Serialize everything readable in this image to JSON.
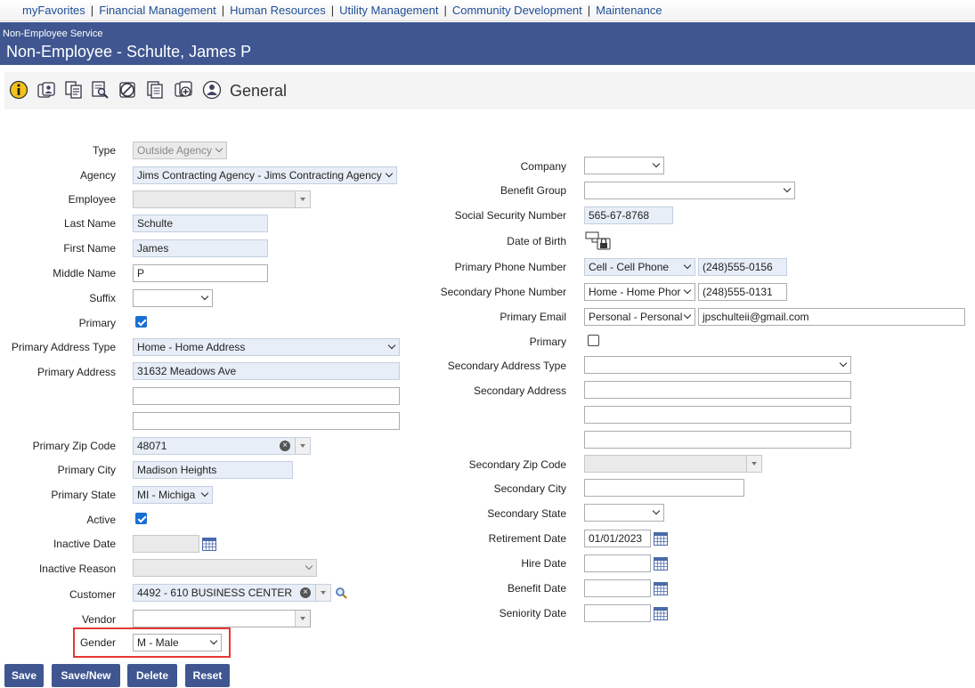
{
  "nav": {
    "items": [
      "myFavorites",
      "Financial Management",
      "Human Resources",
      "Utility Management",
      "Community Development",
      "Maintenance"
    ],
    "separator": "|"
  },
  "header": {
    "module": "Non-Employee Service",
    "title": "Non-Employee - Schulte, James P"
  },
  "toolbar": {
    "title": "General",
    "icons": [
      "info-icon",
      "people-icon",
      "copy-document-icon",
      "search-document-icon",
      "cancel-icon",
      "pages-icon",
      "add-group-icon",
      "person-icon"
    ]
  },
  "left": {
    "type": {
      "label": "Type",
      "value": "Outside Agency"
    },
    "agency": {
      "label": "Agency",
      "value": "Jims Contracting Agency - Jims Contracting Agency"
    },
    "employee": {
      "label": "Employee",
      "value": ""
    },
    "last_name": {
      "label": "Last  Name",
      "value": "Schulte"
    },
    "first_name": {
      "label": "First Name",
      "value": "James"
    },
    "middle_name": {
      "label": "Middle Name",
      "value": "P"
    },
    "suffix": {
      "label": "Suffix",
      "value": ""
    },
    "primary": {
      "label": "Primary",
      "checked": true
    },
    "primary_address_type": {
      "label": "Primary Address Type",
      "value": "Home - Home Address"
    },
    "primary_address": {
      "label": "Primary Address",
      "line1": "31632 Meadows Ave",
      "line2": "",
      "line3": ""
    },
    "primary_zip": {
      "label": "Primary Zip Code",
      "value": "48071"
    },
    "primary_city": {
      "label": "Primary City",
      "value": "Madison Heights"
    },
    "primary_state": {
      "label": "Primary State",
      "value": "MI - Michiga"
    },
    "active": {
      "label": "Active",
      "checked": true
    },
    "inactive_date": {
      "label": "Inactive Date",
      "value": ""
    },
    "inactive_reason": {
      "label": "Inactive Reason",
      "value": ""
    },
    "customer": {
      "label": "Customer",
      "value": "4492 - 610 BUSINESS CENTER"
    },
    "vendor": {
      "label": "Vendor",
      "value": ""
    },
    "gender": {
      "label": "Gender",
      "value": "M - Male"
    }
  },
  "right": {
    "company": {
      "label": "Company",
      "value": ""
    },
    "benefit_group": {
      "label": "Benefit Group",
      "value": ""
    },
    "ssn": {
      "label": "Social Security Number",
      "value": "565-67-8768"
    },
    "dob": {
      "label": "Date of Birth"
    },
    "primary_phone": {
      "label": "Primary Phone Number",
      "type": "Cell - Cell Phone",
      "value": "(248)555-0156"
    },
    "secondary_phone": {
      "label": "Secondary Phone Number",
      "type": "Home - Home Phor",
      "value": "(248)555-0131"
    },
    "primary_email": {
      "label": "Primary Email",
      "type": "Personal - Personal",
      "value": "jpschulteii@gmail.com"
    },
    "primary": {
      "label": "Primary",
      "checked": false
    },
    "secondary_address_type": {
      "label": "Secondary Address Type",
      "value": ""
    },
    "secondary_address": {
      "label": "Secondary Address",
      "line1": "",
      "line2": "",
      "line3": ""
    },
    "secondary_zip": {
      "label": "Secondary Zip Code",
      "value": ""
    },
    "secondary_city": {
      "label": "Secondary City",
      "value": ""
    },
    "secondary_state": {
      "label": "Secondary State",
      "value": ""
    },
    "retirement_date": {
      "label": "Retirement Date",
      "value": "01/01/2023"
    },
    "hire_date": {
      "label": "Hire Date",
      "value": ""
    },
    "benefit_date": {
      "label": "Benefit Date",
      "value": ""
    },
    "seniority_date": {
      "label": "Seniority Date",
      "value": ""
    }
  },
  "buttons": {
    "save": "Save",
    "save_new": "Save/New",
    "delete": "Delete",
    "reset": "Reset"
  },
  "colors": {
    "header_bg": "#3f5690",
    "link": "#1f4e96",
    "highlight": "#e53935",
    "checkbox": "#1a6fd6",
    "readonly_bg": "#e8eef7"
  }
}
